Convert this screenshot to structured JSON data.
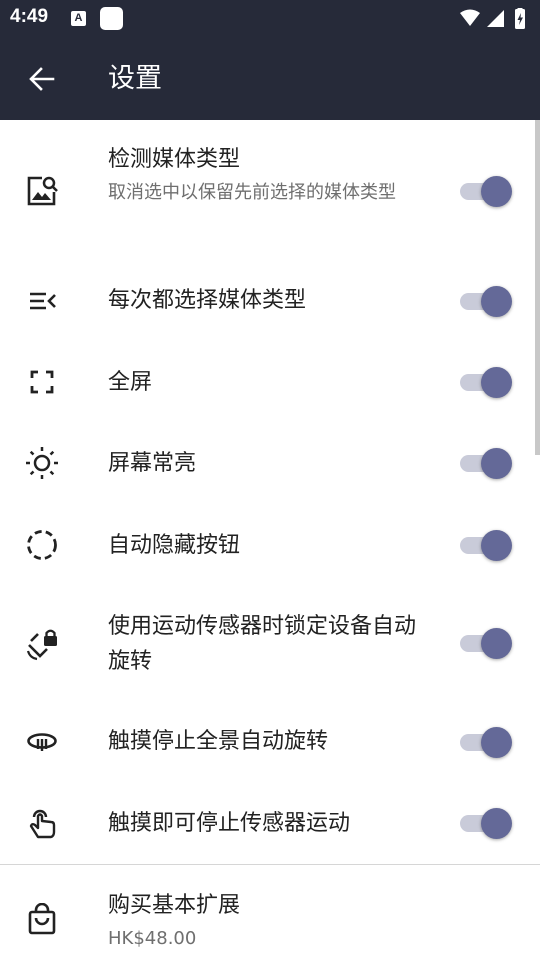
{
  "status": {
    "time": "4:49",
    "a_badge": "A"
  },
  "appbar": {
    "title": "设置"
  },
  "settings": [
    {
      "title": "检测媒体类型",
      "summary": "取消选中以保留先前选择的媒体类型",
      "enabled": true
    },
    {
      "title": "每次都选择媒体类型",
      "enabled": true
    },
    {
      "title": "全屏",
      "enabled": true
    },
    {
      "title": "屏幕常亮",
      "enabled": true
    },
    {
      "title": "自动隐藏按钮",
      "enabled": true
    },
    {
      "title": "使用运动传感器时锁定设备自动旋转",
      "enabled": true
    },
    {
      "title": "触摸停止全景自动旋转",
      "enabled": true
    },
    {
      "title": "触摸即可停止传感器运动",
      "enabled": true
    }
  ],
  "purchase": {
    "title": "购买基本扩展",
    "price": "HK$48.00"
  },
  "colors": {
    "bar": "#262a39",
    "switch_thumb": "#646998",
    "switch_track": "#c9cbd9"
  }
}
